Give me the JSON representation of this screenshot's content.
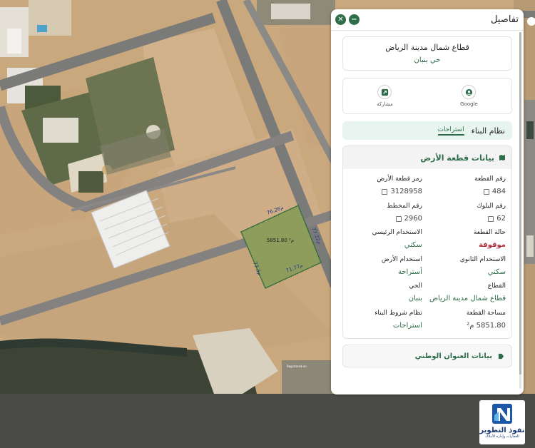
{
  "panel": {
    "title": "تفاصيل",
    "district_title": "قطاع شمال مدينة الرياض",
    "district_sub": "حي بنبان",
    "actions": [
      {
        "label": "مشاركة",
        "icon": "share-icon"
      },
      {
        "label": "Google",
        "icon": "google-maps-icon"
      }
    ],
    "tabs": {
      "main": "نظام البناء",
      "sub": "استراحات"
    },
    "land_data": {
      "title": "بيانات قطعة الأرض",
      "fields": [
        {
          "label": "رقم القطعة",
          "value": "484",
          "copy": true
        },
        {
          "label": "رمز قطعة الأرض",
          "value": "3128958",
          "copy": true
        },
        {
          "label": "رقم البلوك",
          "value": "62",
          "copy": true
        },
        {
          "label": "رقم المخطط",
          "value": "2960",
          "copy": true
        },
        {
          "label": "حالة القطعة",
          "value": "موقوفة",
          "style": "red"
        },
        {
          "label": "الاستخدام الرئيسي",
          "value": "سكني",
          "style": "green"
        },
        {
          "label": "الاستخدام الثانوي",
          "value": "سكني",
          "style": "green"
        },
        {
          "label": "استخدام الأرض",
          "value": "أستراحة",
          "style": "green"
        },
        {
          "label": "القطاع",
          "value": "قطاع شمال مدينة الرياض",
          "style": "green"
        },
        {
          "label": "الحي",
          "value": "بنبان",
          "style": "green"
        },
        {
          "label": "مساحة القطعة",
          "value": "5851.80 م²"
        },
        {
          "label": "نظام شروط البناء",
          "value": "استراحات",
          "style": "green"
        }
      ]
    },
    "address": {
      "title": "بيانات العنوان الوطني"
    }
  },
  "map": {
    "measure_top": "76.26م",
    "measure_right": "77.22م",
    "measure_bottom": "71.77م",
    "measure_left": "77.3م",
    "plot_area": "5851.80 م²",
    "registered_label": "Registered on"
  },
  "logo": {
    "name": "نفوذ التطوير",
    "sub": "للعقارات وإدارة الأملاك"
  },
  "colors": {
    "brand_green": "#2e6d4a",
    "status_red": "#b0303a",
    "plot_outline": "#2d6b3c",
    "logo_blue": "#1b3a73"
  }
}
